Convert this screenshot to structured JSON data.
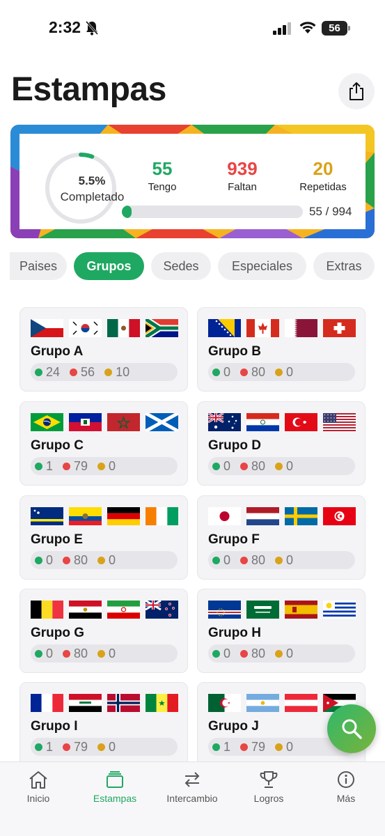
{
  "status_bar": {
    "time": "2:32",
    "battery": "56"
  },
  "header": {
    "title": "Estampas"
  },
  "progress": {
    "percent_label": "5.5%",
    "completed_label": "Completado",
    "percent_value": 0.055,
    "have": "55",
    "have_label": "Tengo",
    "missing": "939",
    "missing_label": "Faltan",
    "repeated": "20",
    "repeated_label": "Repetidas",
    "count_label": "55 / 994",
    "colors": {
      "have": "#1fa862",
      "missing": "#e84545",
      "repeated": "#d9a21a"
    }
  },
  "tabs": [
    {
      "label": "Paises",
      "active": false
    },
    {
      "label": "Grupos",
      "active": true
    },
    {
      "label": "Sedes",
      "active": false
    },
    {
      "label": "Especiales",
      "active": false
    },
    {
      "label": "Extras",
      "active": false
    }
  ],
  "groups": [
    {
      "name": "Grupo A",
      "flags": [
        "czech-republic",
        "south-korea",
        "mexico",
        "south-africa"
      ],
      "have": "24",
      "missing": "56",
      "repeated": "10"
    },
    {
      "name": "Grupo B",
      "flags": [
        "bosnia",
        "canada",
        "qatar",
        "switzerland"
      ],
      "have": "0",
      "missing": "80",
      "repeated": "0"
    },
    {
      "name": "Grupo C",
      "flags": [
        "brazil",
        "haiti",
        "morocco",
        "scotland"
      ],
      "have": "1",
      "missing": "79",
      "repeated": "0"
    },
    {
      "name": "Grupo D",
      "flags": [
        "australia",
        "paraguay",
        "turkey",
        "usa"
      ],
      "have": "0",
      "missing": "80",
      "repeated": "0"
    },
    {
      "name": "Grupo E",
      "flags": [
        "curacao",
        "ecuador",
        "germany",
        "ivory-coast"
      ],
      "have": "0",
      "missing": "80",
      "repeated": "0"
    },
    {
      "name": "Grupo F",
      "flags": [
        "japan",
        "netherlands",
        "sweden",
        "tunisia"
      ],
      "have": "0",
      "missing": "80",
      "repeated": "0"
    },
    {
      "name": "Grupo G",
      "flags": [
        "belgium",
        "egypt",
        "iran",
        "new-zealand"
      ],
      "have": "0",
      "missing": "80",
      "repeated": "0"
    },
    {
      "name": "Grupo H",
      "flags": [
        "cape-verde",
        "saudi-arabia",
        "spain",
        "uruguay"
      ],
      "have": "0",
      "missing": "80",
      "repeated": "0"
    },
    {
      "name": "Grupo I",
      "flags": [
        "france",
        "iraq",
        "norway",
        "senegal"
      ],
      "have": "1",
      "missing": "79",
      "repeated": "0"
    },
    {
      "name": "Grupo J",
      "flags": [
        "algeria",
        "argentina",
        "austria",
        "jordan"
      ],
      "have": "1",
      "missing": "79",
      "repeated": "0"
    }
  ],
  "nav": [
    {
      "label": "Inicio",
      "icon": "home-icon",
      "active": false
    },
    {
      "label": "Estampas",
      "icon": "cards-icon",
      "active": true
    },
    {
      "label": "Intercambio",
      "icon": "swap-icon",
      "active": false
    },
    {
      "label": "Logros",
      "icon": "trophy-icon",
      "active": false
    },
    {
      "label": "Más",
      "icon": "info-icon",
      "active": false
    }
  ]
}
